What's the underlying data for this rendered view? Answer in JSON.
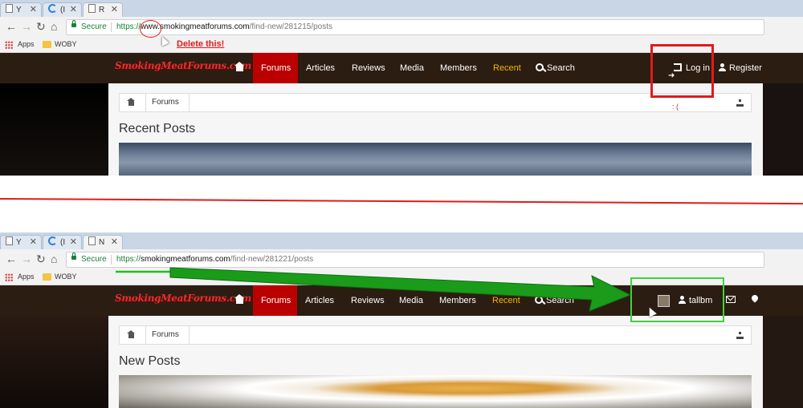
{
  "top": {
    "tabs": [
      {
        "label": "Y",
        "icon": "document-icon"
      },
      {
        "label": "(I",
        "icon": "loading-icon"
      },
      {
        "label": "R",
        "icon": "document-icon"
      }
    ],
    "address": {
      "secure": "Secure",
      "protocol": "https://",
      "host": "www.smokingmeatforums.com",
      "path": "/find-new/281215/posts"
    },
    "bookmarks": {
      "apps": "Apps",
      "folder": "WOBY"
    },
    "nav": {
      "logo": "SmokingMeatForums.com",
      "items": [
        "Forums",
        "Articles",
        "Reviews",
        "Media",
        "Members",
        "Recent",
        "Search"
      ],
      "login": "Log in",
      "register": "Register"
    },
    "breadcrumb": "Forums",
    "page_title": "Recent Posts",
    "annotation": "Delete this!",
    "frown": ": ("
  },
  "bottom": {
    "tabs": [
      {
        "label": "Y",
        "icon": "document-icon"
      },
      {
        "label": "(I",
        "icon": "loading-icon"
      },
      {
        "label": "N",
        "icon": "document-icon"
      }
    ],
    "address": {
      "secure": "Secure",
      "protocol": "https://",
      "host": "smokingmeatforums.com",
      "path": "/find-new/281221/posts"
    },
    "bookmarks": {
      "apps": "Apps",
      "folder": "WOBY"
    },
    "nav": {
      "logo": "SmokingMeatForums.com",
      "items": [
        "Forums",
        "Articles",
        "Reviews",
        "Media",
        "Members",
        "Recent",
        "Search"
      ],
      "username": "tallbm"
    },
    "breadcrumb": "Forums",
    "page_title": "New Posts"
  },
  "colors": {
    "nav_bg": "#2c1d12",
    "active": "#bb0000",
    "recent": "#f5b400",
    "annot_red": "#e01b1b",
    "annot_green": "#1a9c1a",
    "secure_green": "#188038"
  }
}
